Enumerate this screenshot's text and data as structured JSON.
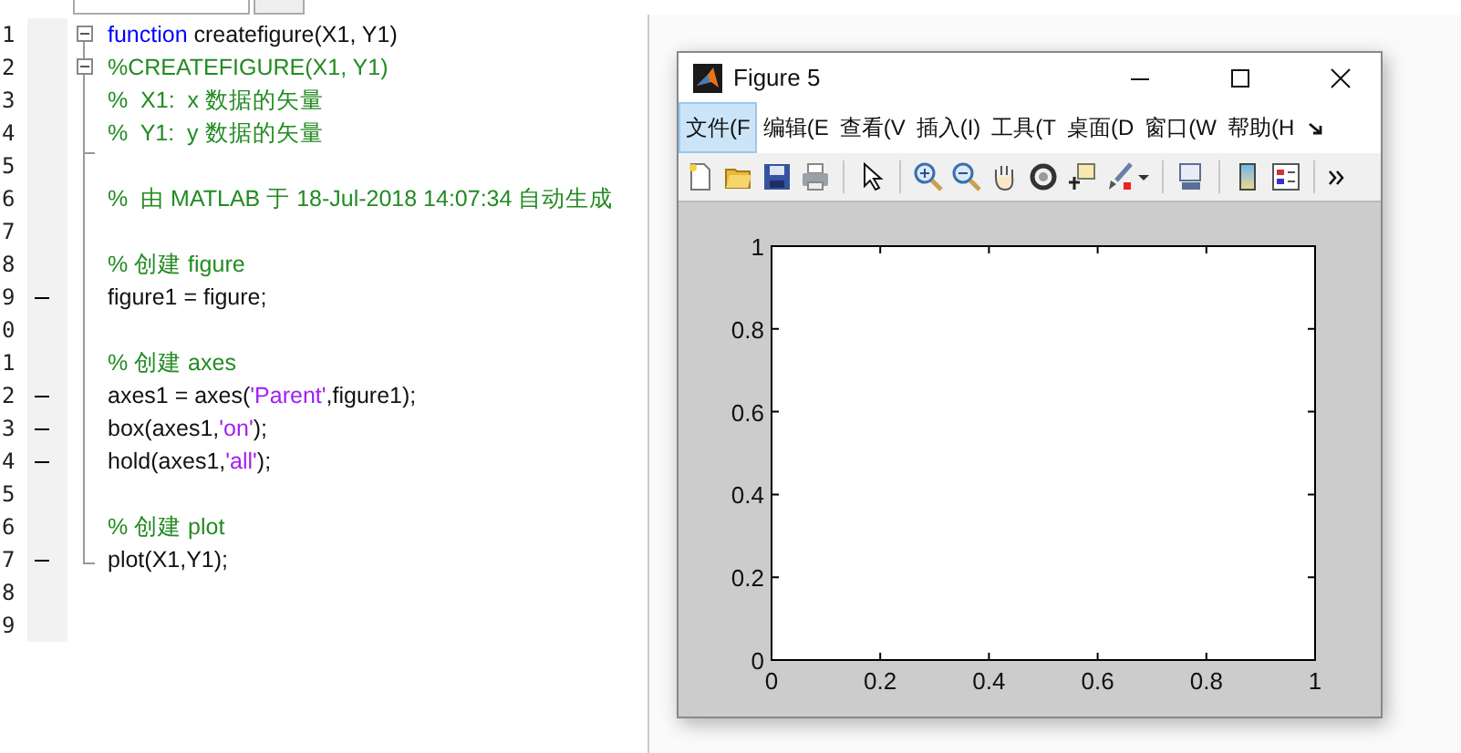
{
  "editor": {
    "lines": [
      {
        "number": "1",
        "executable": false,
        "fold_toggle": true,
        "tokens": [
          {
            "kind": "keyword",
            "text": "function"
          },
          {
            "kind": "code",
            "text": " createfigure(X1, Y1)"
          }
        ]
      },
      {
        "number": "2",
        "executable": false,
        "fold_toggle": true,
        "tokens": [
          {
            "kind": "comment",
            "text": "%CREATEFIGURE(X1, Y1)"
          }
        ]
      },
      {
        "number": "3",
        "executable": false,
        "fold_toggle": false,
        "tokens": [
          {
            "kind": "comment",
            "text": "%  X1:  x 数据的矢量"
          }
        ]
      },
      {
        "number": "4",
        "executable": false,
        "fold_toggle": false,
        "tokens": [
          {
            "kind": "comment",
            "text": "%  Y1:  y 数据的矢量"
          }
        ]
      },
      {
        "number": "5",
        "executable": false,
        "fold_toggle": false
      },
      {
        "number": "6",
        "executable": false,
        "fold_toggle": false,
        "tokens": [
          {
            "kind": "comment",
            "text": "%  由 MATLAB 于 18-Jul-2018 14:07:34 自动生成"
          }
        ]
      },
      {
        "number": "7",
        "executable": false,
        "fold_toggle": false
      },
      {
        "number": "8",
        "executable": false,
        "fold_toggle": false,
        "tokens": [
          {
            "kind": "comment",
            "text": "% 创建 figure"
          }
        ]
      },
      {
        "number": "9",
        "executable": true,
        "fold_toggle": false,
        "tokens": [
          {
            "kind": "code",
            "text": "figure1 = figure;"
          }
        ]
      },
      {
        "number": "0",
        "executable": false,
        "fold_toggle": false
      },
      {
        "number": "1",
        "executable": false,
        "fold_toggle": false,
        "tokens": [
          {
            "kind": "comment",
            "text": "% 创建 axes"
          }
        ]
      },
      {
        "number": "2",
        "executable": true,
        "fold_toggle": false,
        "tokens": [
          {
            "kind": "code",
            "text": "axes1 = axes("
          },
          {
            "kind": "string",
            "text": "'Parent'"
          },
          {
            "kind": "code",
            "text": ",figure1);"
          }
        ]
      },
      {
        "number": "3",
        "executable": true,
        "fold_toggle": false,
        "tokens": [
          {
            "kind": "code",
            "text": "box(axes1,"
          },
          {
            "kind": "string",
            "text": "'on'"
          },
          {
            "kind": "code",
            "text": ");"
          }
        ]
      },
      {
        "number": "4",
        "executable": true,
        "fold_toggle": false,
        "tokens": [
          {
            "kind": "code",
            "text": "hold(axes1,"
          },
          {
            "kind": "string",
            "text": "'all'"
          },
          {
            "kind": "code",
            "text": ");"
          }
        ]
      },
      {
        "number": "5",
        "executable": false,
        "fold_toggle": false
      },
      {
        "number": "6",
        "executable": false,
        "fold_toggle": false,
        "tokens": [
          {
            "kind": "comment",
            "text": "% 创建 plot"
          }
        ]
      },
      {
        "number": "7",
        "executable": true,
        "fold_toggle": false,
        "tokens": [
          {
            "kind": "code",
            "text": "plot(X1,Y1);"
          }
        ]
      },
      {
        "number": "8",
        "executable": false,
        "fold_toggle": false
      },
      {
        "number": "9",
        "executable": false,
        "fold_toggle": false
      }
    ]
  },
  "figure_window": {
    "title": "Figure 5",
    "menu": [
      {
        "label": "文件(F",
        "selected": true
      },
      {
        "label": "编辑(E",
        "selected": false
      },
      {
        "label": "查看(V",
        "selected": false
      },
      {
        "label": "插入(I)",
        "selected": false
      },
      {
        "label": "工具(T",
        "selected": false
      },
      {
        "label": "桌面(D",
        "selected": false
      },
      {
        "label": "窗口(W",
        "selected": false
      },
      {
        "label": "帮助(H",
        "selected": false
      }
    ],
    "chart_data": {
      "type": "line",
      "xlim": [
        0,
        1
      ],
      "ylim": [
        0,
        1
      ],
      "xticks": [
        0,
        0.2,
        0.4,
        0.6,
        0.8,
        1
      ],
      "yticks": [
        0,
        0.2,
        0.4,
        0.6,
        0.8,
        1
      ]
    }
  }
}
